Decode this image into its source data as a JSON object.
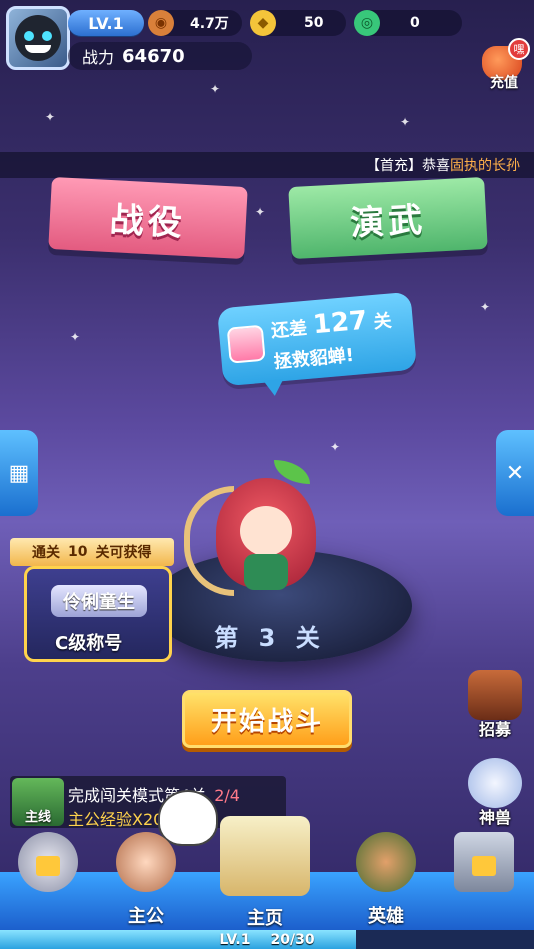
{
  "player": {
    "level": "LV.1",
    "copper": "4.7万",
    "gold": "50",
    "jade": "0",
    "power_label": "战力",
    "power_value": "64670"
  },
  "recharge": {
    "label": "充值",
    "badge": "嘿"
  },
  "ticker": {
    "prefix": "【首充】恭喜",
    "name": "固执的长孙"
  },
  "modes": {
    "battle": "战役",
    "martial": "演武"
  },
  "bubble": {
    "line1_a": "还差",
    "line1_num": "127",
    "line1_b": "关",
    "line2": "拯救貂蝉!"
  },
  "reward": {
    "tag_a": "通关",
    "tag_num": "10",
    "tag_b": "关可获得",
    "name": "伶俐童生",
    "grade": "C级称号"
  },
  "stage": {
    "label": "第 3 关"
  },
  "start_button": "开始战斗",
  "side_icons": {
    "recruit": "招募",
    "beast": "神兽"
  },
  "quest": {
    "type": "主线",
    "title": "完成闯关模式第4关",
    "progress": "2/4",
    "reward": "主公经验X20"
  },
  "nav": {
    "lord": "主公",
    "home": "主页",
    "heroes": "英雄"
  },
  "xp": {
    "level": "LV.1",
    "progress": "20/30",
    "fraction": 0.667
  },
  "colors": {
    "accent": "#ffb04a",
    "start": "#ff9f1a",
    "nav": "#2b7de0"
  }
}
